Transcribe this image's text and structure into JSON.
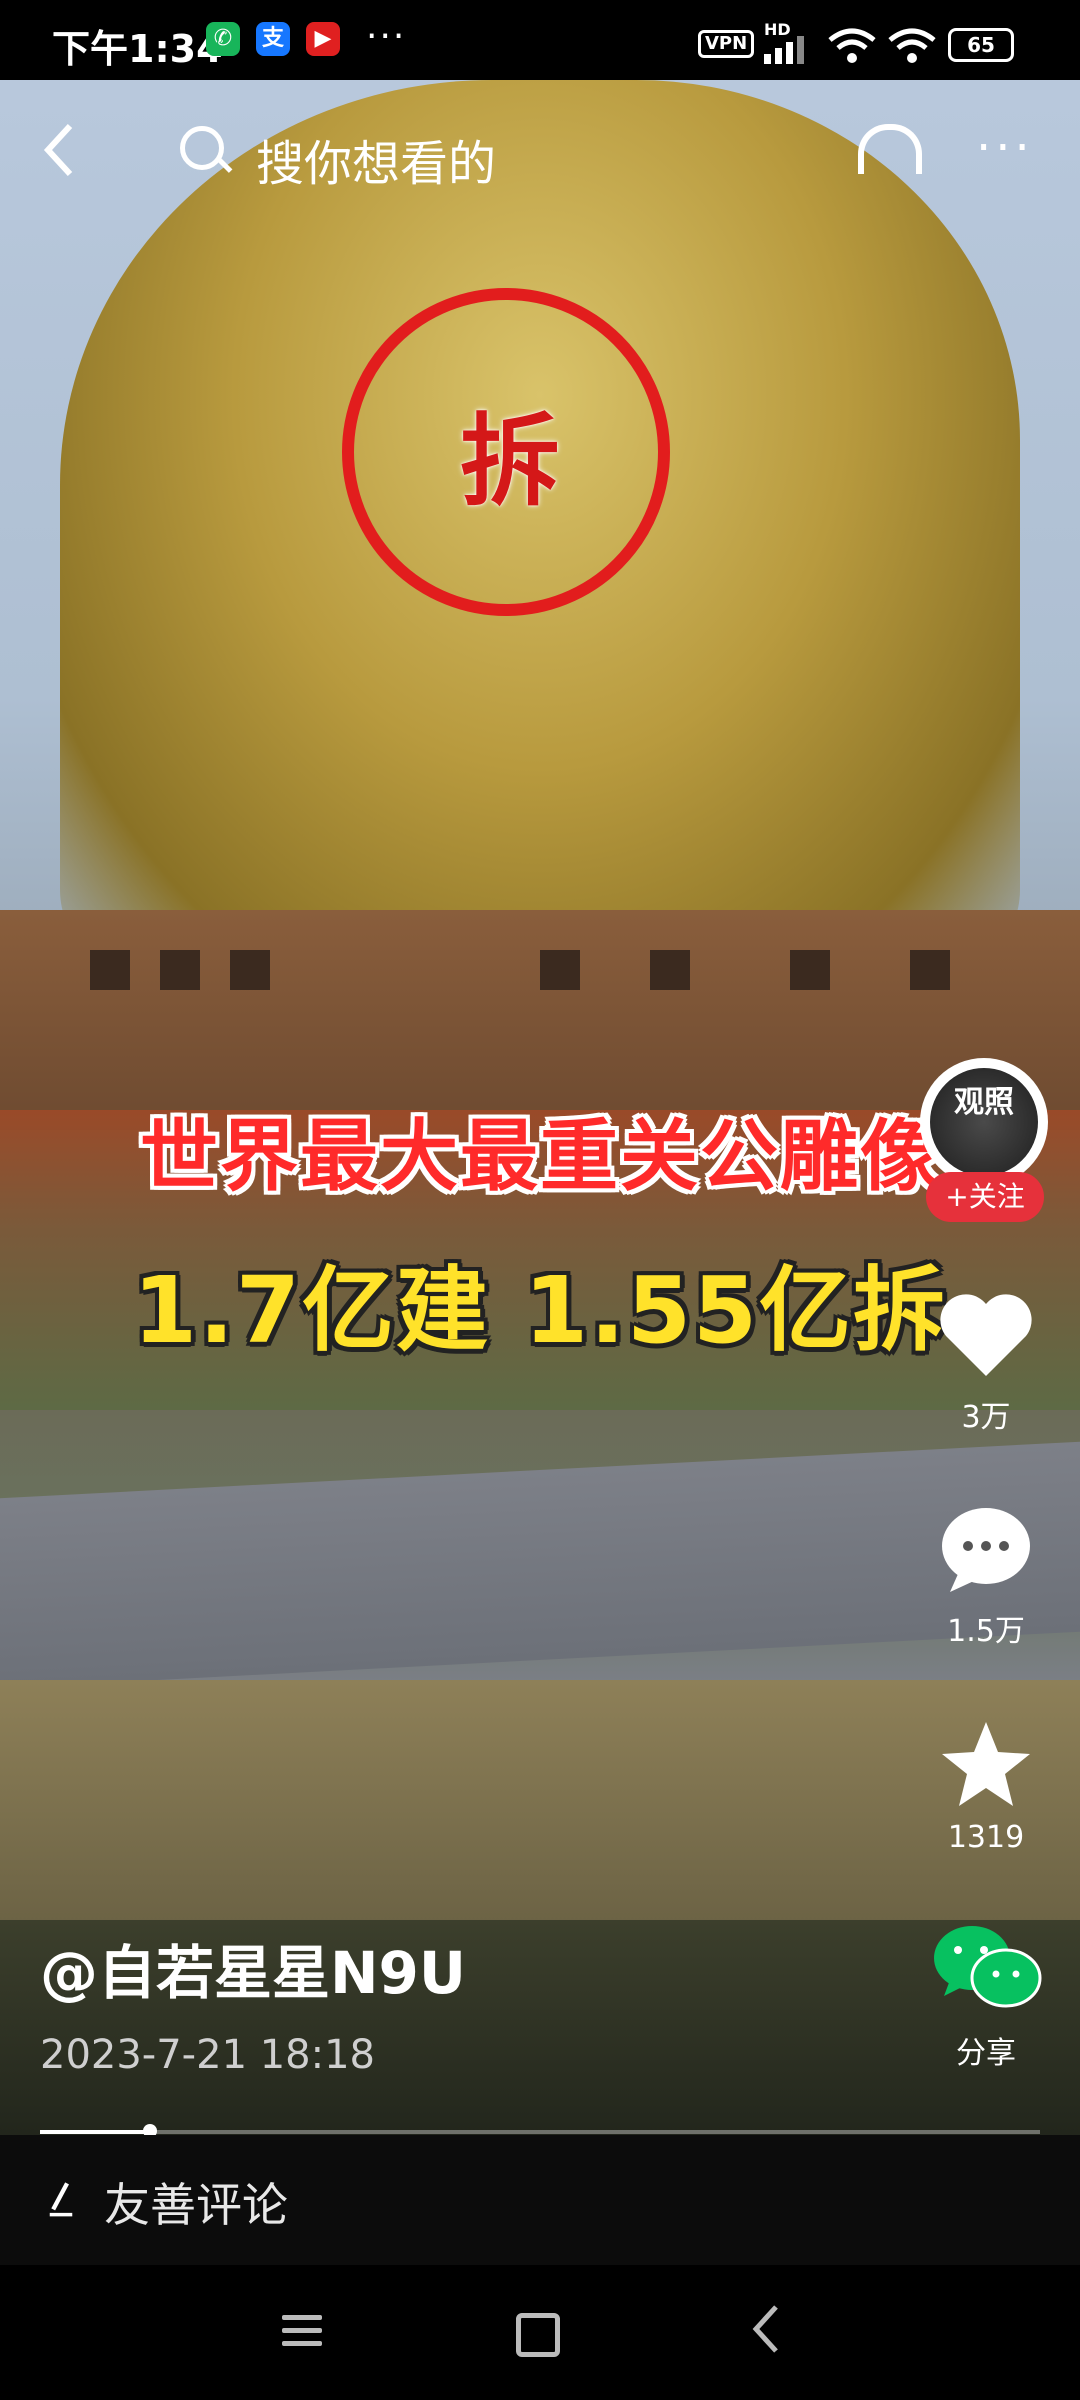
{
  "status_bar": {
    "time": "下午1:34",
    "icons": [
      "phone-icon",
      "alipay-icon",
      "youtube-icon"
    ],
    "overflow": "···",
    "vpn": "VPN",
    "network": "HD",
    "battery": "65"
  },
  "top_nav": {
    "search_placeholder": "搜你想看的"
  },
  "video": {
    "overlay_circle_text": "拆",
    "caption_line1": "世界最大最重关公雕像",
    "caption_line2": "1.7亿建 1.55亿拆",
    "progress_fraction": 0.11
  },
  "author": {
    "avatar_text": "观照",
    "follow_label": "+关注",
    "username": "@自若星星N9U",
    "date": "2023-7-21 18:18"
  },
  "actions": {
    "likes": "3万",
    "comments": "1.5万",
    "favorites": "1319",
    "share": "分享"
  },
  "comment_bar": {
    "placeholder": "友善评论"
  },
  "colors": {
    "follow_bg": "#e6313b",
    "caption_red": "#ff2a2a",
    "caption_yellow": "#ffe22a",
    "wechat_green": "#07c160"
  }
}
